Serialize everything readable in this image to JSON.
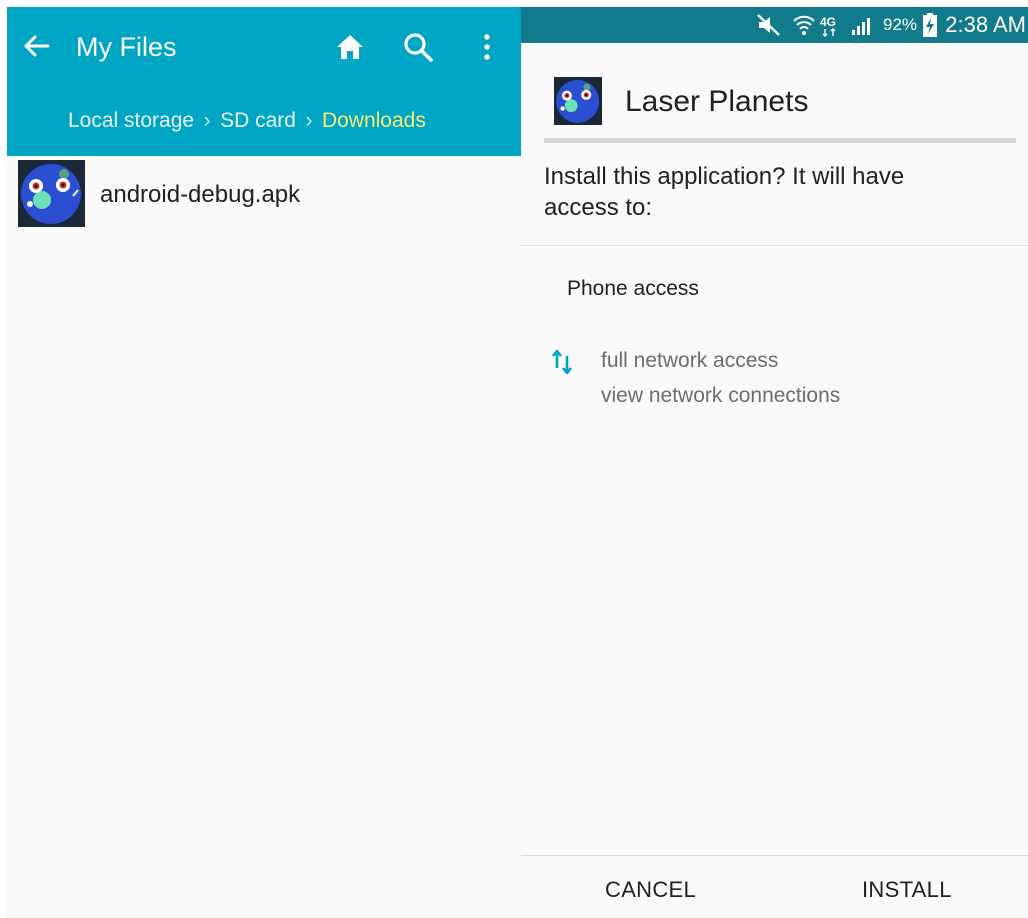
{
  "file_manager": {
    "title": "My Files",
    "breadcrumb": [
      "Local storage",
      "SD card",
      "Downloads"
    ],
    "files": [
      {
        "name": "android-debug.apk",
        "icon": "planet-app-icon"
      }
    ],
    "colors": {
      "header": "#00a5c4",
      "current_crumb": "#f3ef7a"
    }
  },
  "status_bar": {
    "battery": "92%",
    "time": "2:38 AM",
    "network": "4G",
    "icons": [
      "mute-icon",
      "wifi-icon",
      "4g-icon",
      "signal-icon",
      "battery-charging-icon"
    ],
    "color": "#117b8b"
  },
  "installer": {
    "app_name": "Laser Planets",
    "question": "Install this application? It will have access to:",
    "permission_group": "Phone access",
    "permissions": [
      "full network access",
      "view network connections"
    ],
    "cancel_label": "CANCEL",
    "install_label": "INSTALL",
    "accent": "#00a5c4"
  }
}
